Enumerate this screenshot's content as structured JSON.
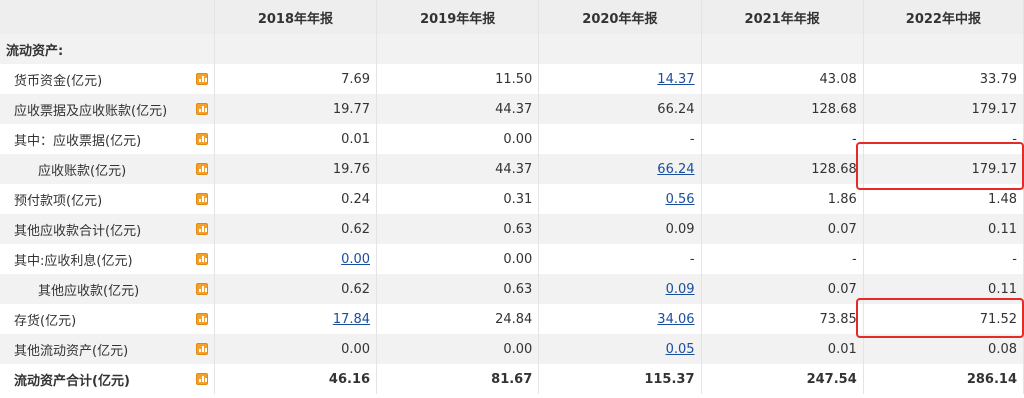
{
  "columns": [
    "2018年年报",
    "2019年年报",
    "2020年年报",
    "2021年年报",
    "2022年中报"
  ],
  "section_title": "流动资产:",
  "rows": [
    {
      "label": "货币资金(亿元)",
      "values": [
        "7.69",
        "11.50",
        "14.37",
        "43.08",
        "33.79"
      ]
    },
    {
      "label": "应收票据及应收账款(亿元)",
      "values": [
        "19.77",
        "44.37",
        "66.24",
        "128.68",
        "179.17"
      ]
    },
    {
      "label": "其中：应收票据(亿元)",
      "values": [
        "0.01",
        "0.00",
        "-",
        "-",
        "-"
      ]
    },
    {
      "label": "应收账款(亿元)",
      "values": [
        "19.76",
        "44.37",
        "66.24",
        "128.68",
        "179.17"
      ]
    },
    {
      "label": "预付款项(亿元)",
      "values": [
        "0.24",
        "0.31",
        "0.56",
        "1.86",
        "1.48"
      ]
    },
    {
      "label": "其他应收款合计(亿元)",
      "values": [
        "0.62",
        "0.63",
        "0.09",
        "0.07",
        "0.11"
      ]
    },
    {
      "label": "其中:应收利息(亿元)",
      "values": [
        "0.00",
        "0.00",
        "-",
        "-",
        "-"
      ]
    },
    {
      "label": "其他应收款(亿元)",
      "values": [
        "0.62",
        "0.63",
        "0.09",
        "0.07",
        "0.11"
      ]
    },
    {
      "label": "存货(亿元)",
      "values": [
        "17.84",
        "24.84",
        "34.06",
        "73.85",
        "71.52"
      ]
    },
    {
      "label": "其他流动资产(亿元)",
      "values": [
        "0.00",
        "0.00",
        "0.05",
        "0.01",
        "0.08"
      ]
    },
    {
      "label": "流动资产合计(亿元)",
      "values": [
        "46.16",
        "81.67",
        "115.37",
        "247.54",
        "286.14"
      ]
    }
  ],
  "icons": {
    "row_chart": "bar-chart-icon"
  },
  "colors": {
    "link": "#1a4fa0",
    "highlight": "#e52a2a",
    "icon": "#f6a02a",
    "header_bg": "#eeeeee",
    "alt_row_bg": "#f2f2f2"
  }
}
